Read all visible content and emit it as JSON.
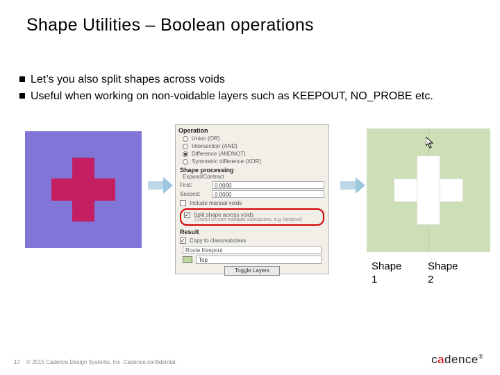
{
  "title": "Shape Utilities – Boolean operations",
  "bullets": [
    "Let’s you also split shapes across voids",
    "Useful when working on non-voidable layers such as KEEPOUT, NO_PROBE etc."
  ],
  "dialog": {
    "operation_label": "Operation",
    "radios": {
      "union": "Union (OR)",
      "intersection": "Intersection (AND)",
      "difference": "Difference (ANDNOT)",
      "symdiff": "Symmetric difference (XOR)"
    },
    "selected_radio": "difference",
    "sp_label": "Shape processing",
    "expand_label": "Expand/Contract",
    "first_label": "First:",
    "first_value": "0.0000",
    "second_label": "Second:",
    "second_value": "0.0000",
    "include_voids": "Include manual voids",
    "split_voids": "Split shape across voids",
    "split_sub": "(Useful on non-voidable subclasses, e.g. keepout)",
    "result_label": "Result",
    "copy_label": "Copy to class/subclass",
    "class_value": "Route Keepout",
    "subclass_value": "Top",
    "toggle_btn": "Toggle Layers"
  },
  "shape_labels": {
    "s1": "Shape 1",
    "s2": "Shape 2"
  },
  "footer": {
    "page": "17",
    "copyright": "© 2015 Cadence Design Systems, Inc. Cadence confidential.",
    "brand_c": "c",
    "brand_a": "a",
    "brand_rest": "dence",
    "reg": "®"
  }
}
